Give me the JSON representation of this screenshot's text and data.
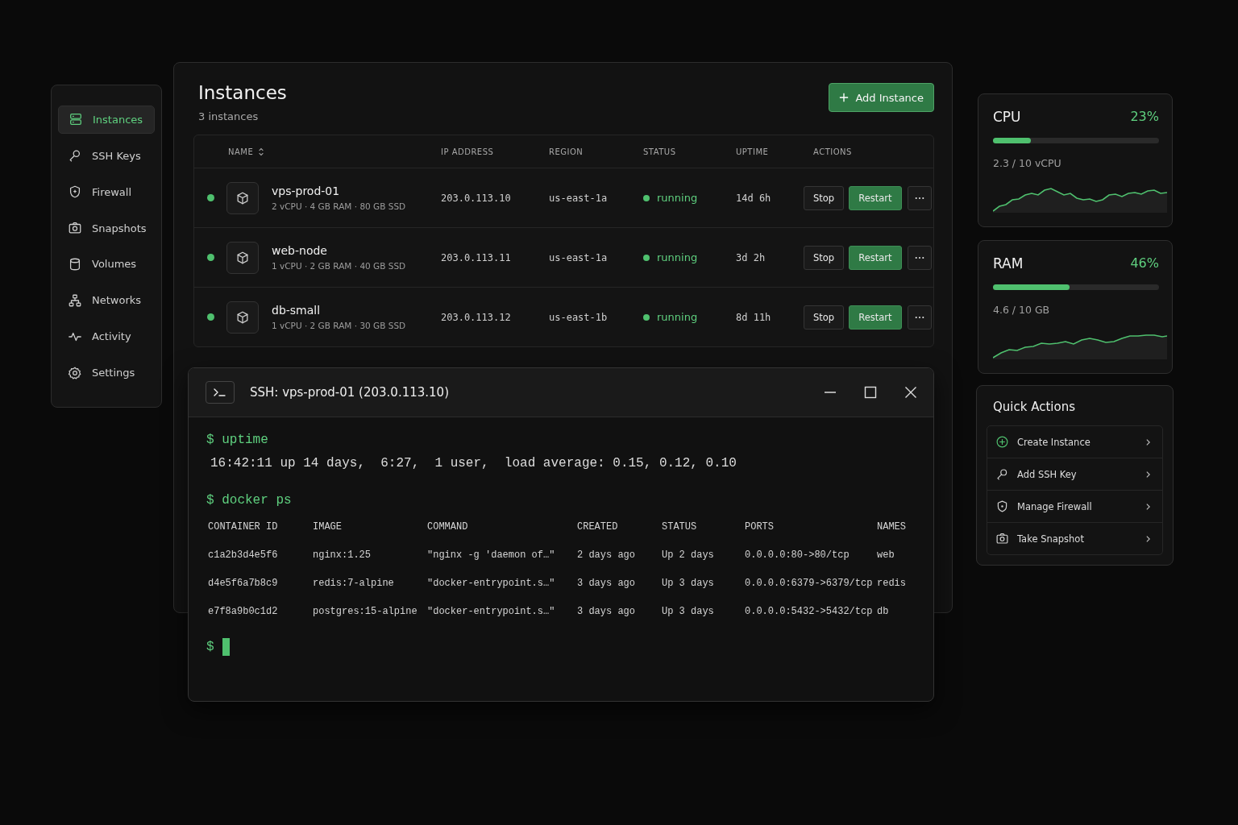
{
  "sidebar": {
    "items": [
      {
        "label": "Instances",
        "kind": "server",
        "selected": true
      },
      {
        "label": "SSH Keys",
        "kind": "key",
        "selected": false
      },
      {
        "label": "Firewall",
        "kind": "shield",
        "selected": false
      },
      {
        "label": "Snapshots",
        "kind": "camera",
        "selected": false
      },
      {
        "label": "Volumes",
        "kind": "database",
        "selected": false
      },
      {
        "label": "Networks",
        "kind": "network",
        "selected": false
      },
      {
        "label": "Activity",
        "kind": "pulse",
        "selected": false
      },
      {
        "label": "Settings",
        "kind": "gear",
        "selected": false
      }
    ]
  },
  "instances": {
    "title": "Instances",
    "subtitle": "3 instances",
    "add_button": "Add Instance",
    "columns": [
      "NAME",
      "IP ADDRESS",
      "REGION",
      "STATUS",
      "UPTIME",
      "ACTIONS"
    ],
    "rows": [
      {
        "name": "vps-prod-01",
        "specs": "2 vCPU · 4 GB RAM · 80 GB SSD",
        "ip": "203.0.113.10",
        "region": "us-east-1a",
        "status": "running",
        "uptime": "14d 6h",
        "actions": [
          {
            "label": "Stop",
            "kind": "secondary"
          },
          {
            "label": "Restart",
            "kind": "primary"
          }
        ]
      },
      {
        "name": "web-node",
        "specs": "1 vCPU · 2 GB RAM · 40 GB SSD",
        "ip": "203.0.113.11",
        "region": "us-east-1a",
        "status": "running",
        "uptime": "3d 2h",
        "actions": [
          {
            "label": "Stop",
            "kind": "secondary"
          },
          {
            "label": "Restart",
            "kind": "primary"
          }
        ]
      },
      {
        "name": "db-small",
        "specs": "1 vCPU · 2 GB RAM · 30 GB SSD",
        "ip": "203.0.113.12",
        "region": "us-east-1b",
        "status": "running",
        "uptime": "8d 11h",
        "actions": [
          {
            "label": "Stop",
            "kind": "secondary"
          },
          {
            "label": "Restart",
            "kind": "primary"
          }
        ]
      }
    ]
  },
  "terminal": {
    "title": "SSH: vps-prod-01 (203.0.113.10)",
    "blocks": [
      {
        "kind": "command",
        "prompt": "$",
        "text": "uptime"
      },
      {
        "kind": "output",
        "text": "16:42:11 up 14 days,  6:27,  1 user,  load average: 0.15, 0.12, 0.10"
      },
      {
        "kind": "command",
        "prompt": "$",
        "text": "docker ps"
      },
      {
        "kind": "table",
        "columns": [
          "CONTAINER ID",
          "IMAGE",
          "COMMAND",
          "CREATED",
          "STATUS",
          "PORTS",
          "NAMES"
        ],
        "rows": [
          [
            "c1a2b3d4e5f6",
            "nginx:1.25",
            "\"nginx -g 'daemon of…\"",
            "2 days ago",
            "Up 2 days",
            "0.0.0.0:80->80/tcp",
            "web"
          ],
          [
            "d4e5f6a7b8c9",
            "redis:7-alpine",
            "\"docker-entrypoint.s…\"",
            "3 days ago",
            "Up 3 days",
            "0.0.0.0:6379->6379/tcp",
            "redis"
          ],
          [
            "e7f8a9b0c1d2",
            "postgres:15-alpine",
            "\"docker-entrypoint.s…\"",
            "3 days ago",
            "Up 3 days",
            "0.0.0.0:5432->5432/tcp",
            "db"
          ]
        ]
      },
      {
        "kind": "cursor",
        "prompt": "$"
      }
    ]
  },
  "metrics": [
    {
      "name": "CPU",
      "percent": "23%",
      "level": 0.23,
      "detail": "2.3 / 10 vCPU"
    },
    {
      "name": "RAM",
      "percent": "46%",
      "level": 0.46,
      "detail": "4.6 / 10 GB"
    }
  ],
  "quick_actions": {
    "title": "Quick Actions",
    "items": [
      {
        "label": "Create Instance",
        "kind": "plus"
      },
      {
        "label": "Add SSH Key",
        "kind": "key"
      },
      {
        "label": "Manage Firewall",
        "kind": "shield"
      },
      {
        "label": "Take Snapshot",
        "kind": "camera"
      }
    ]
  }
}
